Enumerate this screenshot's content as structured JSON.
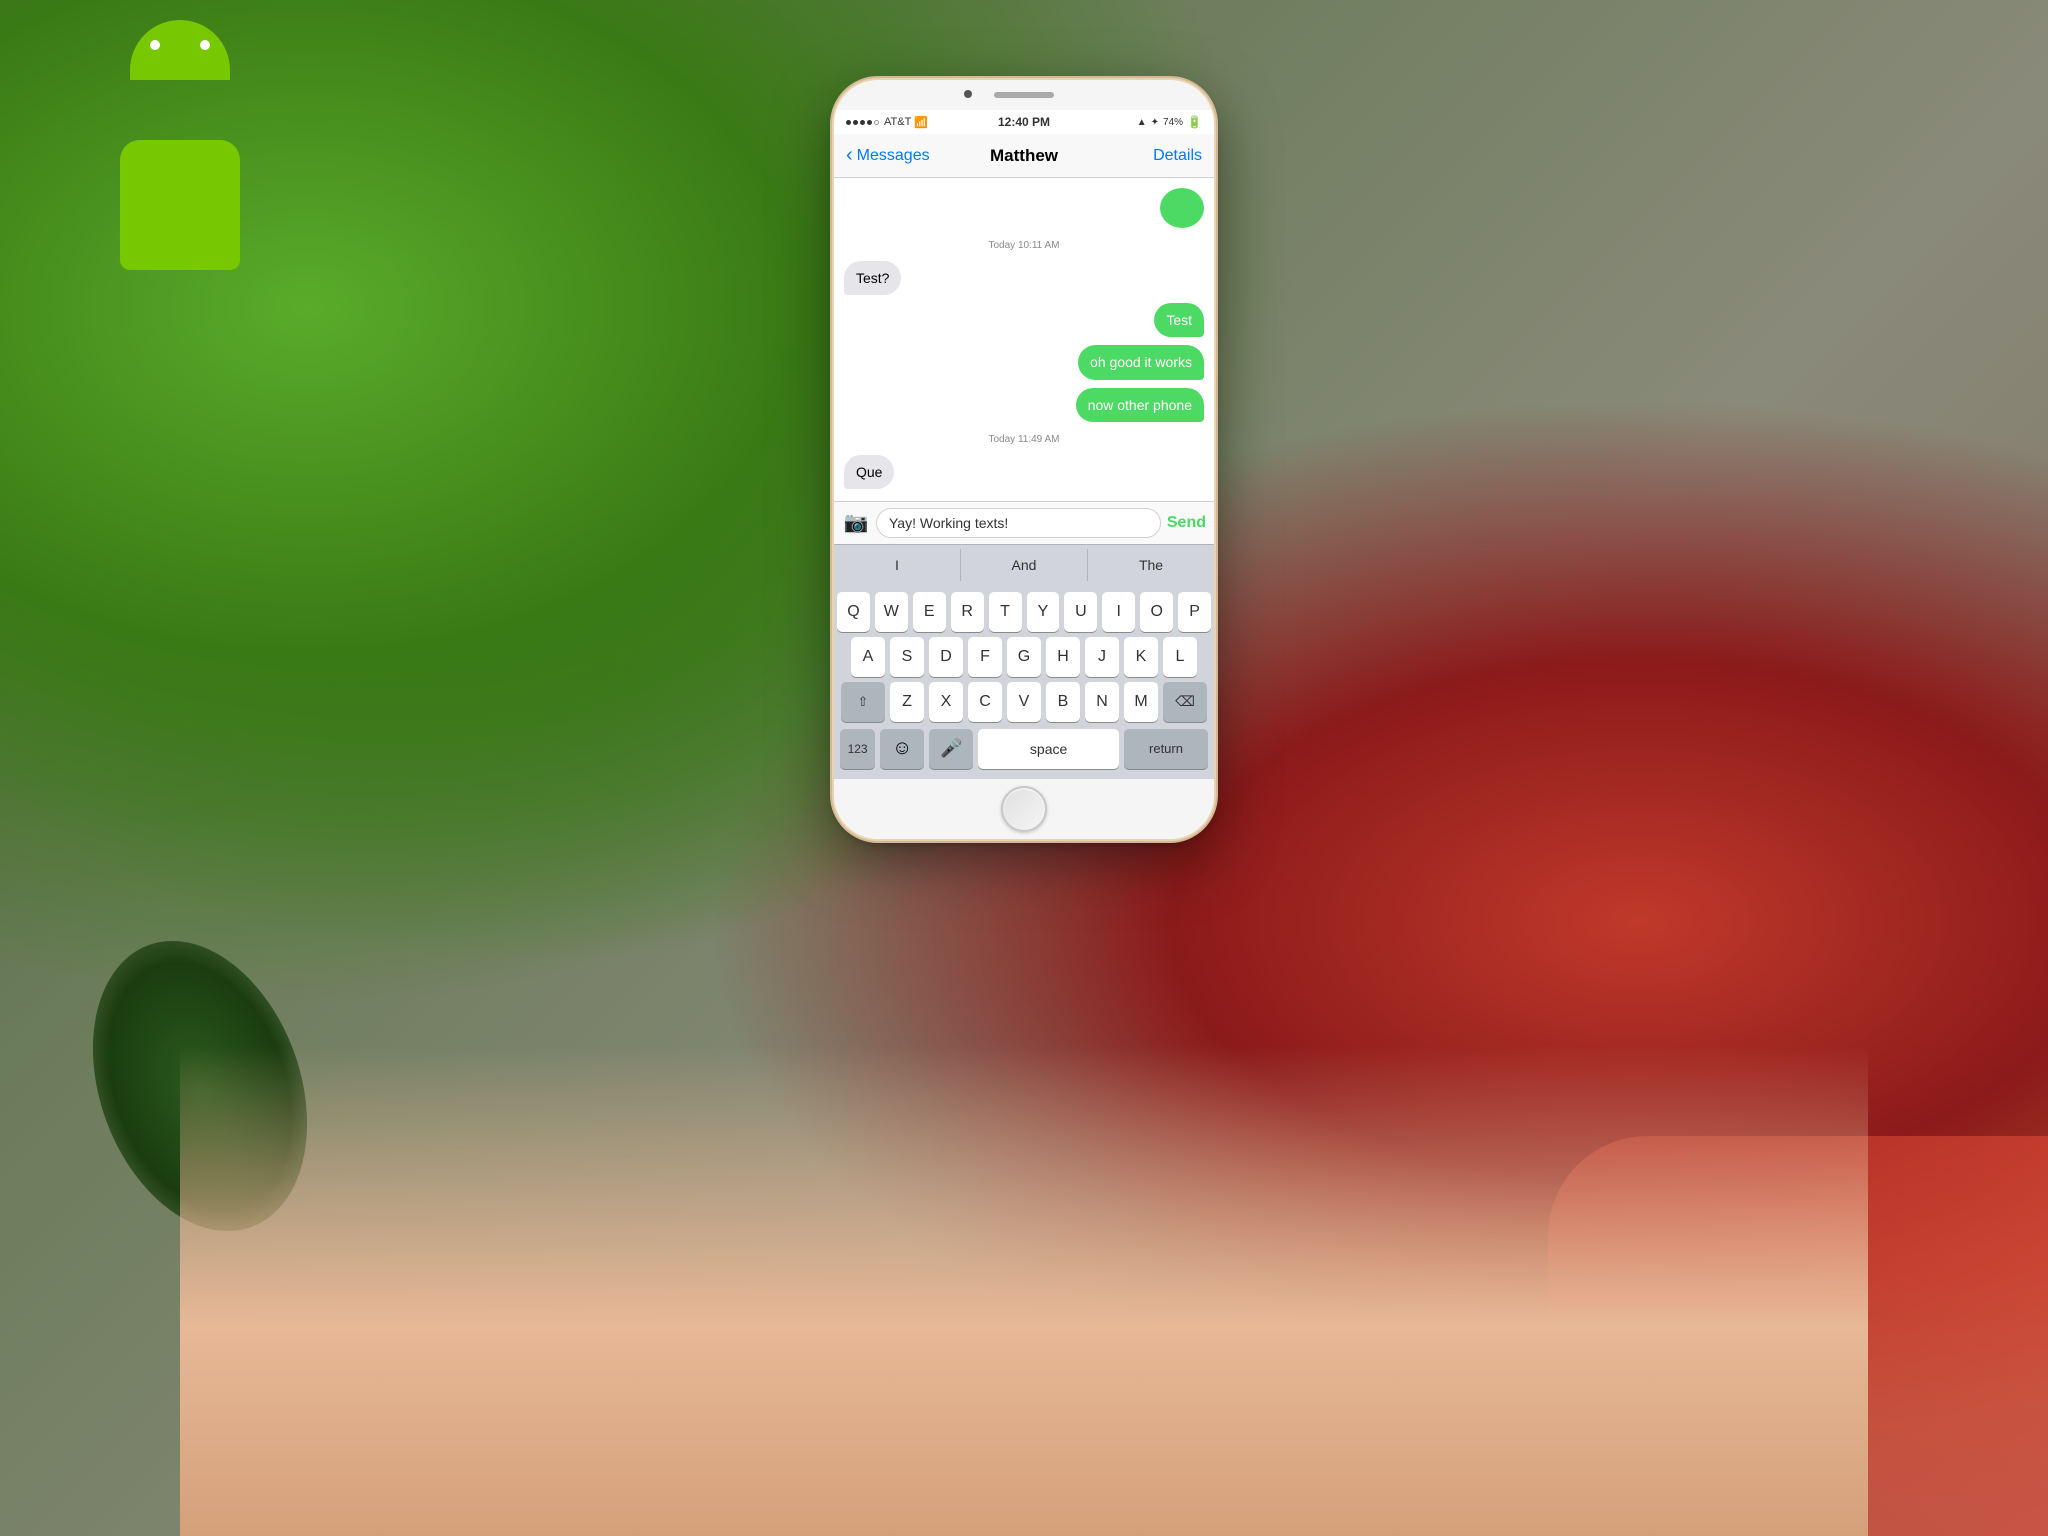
{
  "background": {
    "color": "#6b7c5a"
  },
  "status_bar": {
    "carrier": "AT&T",
    "wifi": "wifi",
    "time": "12:40 PM",
    "signal": "▲",
    "bluetooth": "✦",
    "battery_percent": "74%",
    "battery": "battery"
  },
  "nav": {
    "back_label": "Messages",
    "title": "Matthew",
    "details_label": "Details"
  },
  "messages": {
    "timestamp1": "Today 10:11 AM",
    "msg1_received": "Test?",
    "msg1_sent": "Test",
    "msg2_sent_1": "oh good it works",
    "msg2_sent_2": "now other phone",
    "timestamp2": "Today 11:49 AM",
    "msg3_received": "Que"
  },
  "input": {
    "camera_icon": "📷",
    "value": "Yay! Working texts!",
    "send_label": "Send"
  },
  "autocomplete": {
    "items": [
      "I",
      "And",
      "The"
    ]
  },
  "keyboard": {
    "row1": [
      "Q",
      "W",
      "E",
      "R",
      "T",
      "Y",
      "U",
      "I",
      "O",
      "P"
    ],
    "row2": [
      "A",
      "S",
      "D",
      "F",
      "G",
      "H",
      "J",
      "K",
      "L"
    ],
    "row3": [
      "Z",
      "X",
      "C",
      "V",
      "B",
      "N",
      "M"
    ],
    "shift_label": "⇧",
    "delete_label": "⌫",
    "number_label": "123",
    "emoji_label": "😊",
    "mic_label": "🎤",
    "space_label": "space",
    "return_label": "return"
  }
}
